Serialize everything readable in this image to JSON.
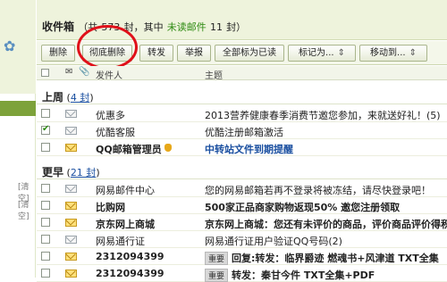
{
  "leftbar": {
    "clear_labels": [
      "[清空]",
      "[清空]"
    ]
  },
  "header": {
    "title": "收件箱",
    "summary_prefix": "（共",
    "total": "573",
    "summary_mid": "封，其中",
    "unread_label": "未读邮件",
    "unread_count": "11",
    "unread_suffix": "封）"
  },
  "toolbar": {
    "delete": "删除",
    "delete_permanently": "彻底删除",
    "forward": "转发",
    "report": "举报",
    "mark_all_read": "全部标为已读",
    "mark_as": "标记为...",
    "move_to": "移动到...",
    "dropdown_glyph": "⇕"
  },
  "columns": {
    "sender": "发件人",
    "subject": "主题"
  },
  "groups": {
    "last_week": {
      "label": "上周",
      "count": "4 封"
    },
    "earlier": {
      "label": "更早",
      "count": "21 封"
    }
  },
  "rows": [
    {
      "sender": "优惠多",
      "subject": "2013营养健康春季消费节邀您参加，来就送好礼！(5)"
    },
    {
      "sender": "优酷客服",
      "subject": "优酷注册邮箱激活"
    },
    {
      "sender": "QQ邮箱管理员",
      "subject": "中转站文件到期提醒"
    },
    {
      "sender": "网易邮件中心",
      "subject": "您的网易邮箱若再不登录将被冻结，请尽快登录吧！"
    },
    {
      "sender": "比购网",
      "subject": "500家正品商家购物返现50% 邀您注册领取"
    },
    {
      "sender": "京东网上商城",
      "subject": "京东网上商城：您还有未评价的商品，评价商品评价得积分"
    },
    {
      "sender": "网易通行证",
      "subject": "网易通行证用户验证QQ号码(2)"
    },
    {
      "sender": "2312094399",
      "tag": "重要",
      "subject": "回复:转发：临界爵迹  燃魂书+风津道  TXT全集"
    },
    {
      "sender": "2312094399",
      "tag": "重要",
      "subject": "转发：秦甘今件 TXT全集+PDF"
    }
  ]
}
